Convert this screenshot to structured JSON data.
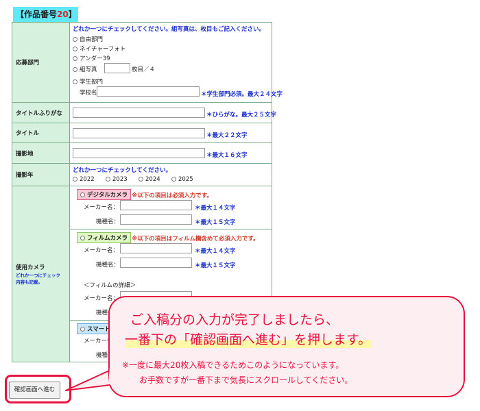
{
  "heading": {
    "prefix": "【作品番号",
    "number": "20",
    "suffix": "】"
  },
  "rows": {
    "category": {
      "label": "応募部門",
      "instruction": "どれか一つにチェックしてください。組写真は、枚目もご記入ください。",
      "options": [
        "自由部門",
        "ネイチャーフォト",
        "アンダー39",
        "組写真",
        "学生部門"
      ],
      "kumi_suffix": "枚目／４",
      "school_label": "学校名",
      "school_note": "＊学生部門必須。最大２４文字"
    },
    "title_kana": {
      "label": "タイトルふりがな",
      "note": "＊ひらがな。最大２５文字"
    },
    "title": {
      "label": "タイトル",
      "note": "＊最大２２文字"
    },
    "location": {
      "label": "撮影地",
      "note": "＊最大１６文字"
    },
    "year": {
      "label": "撮影年",
      "instruction": "どれか一つにチェックしてください。",
      "options": [
        "2022",
        "2023",
        "2024",
        "2025"
      ]
    },
    "camera": {
      "label": "使用カメラ",
      "label_note1": "どれか一つにチェック",
      "label_note2": "内容も記載。",
      "digital": {
        "name": "デジタルカメラ",
        "note": "※以下の項目は必須入力です。"
      },
      "film": {
        "name": "フィルムカメラ",
        "note": "※以下の項目はフィルム欄含めて必須入力です。"
      },
      "smart": {
        "name": "スマート"
      },
      "maker_label": "メーカー名：",
      "model_label": "機種名：",
      "model_label_cut": "機種名",
      "maker_note": "＊最大１４文字",
      "model_note": "＊最大１５文字",
      "film_detail": "＜フィルムの詳細＞"
    }
  },
  "confirm_button": "確認画面へ進む",
  "bubble": {
    "line1": "ご入稿分の入力が完了しましたら、",
    "line2": "一番下の「確認画面へ進む」を押します。",
    "note1": "※一度に最大20枚入稿できるためこのようになっています。",
    "note2": "お手数ですが一番下まで気長にスクロールしてください。"
  },
  "colors": {
    "accent": "#e8123f",
    "label_bg": "#d6f2de",
    "heading_bg": "#5fe8f5",
    "note_blue": "#1a2fd1"
  }
}
